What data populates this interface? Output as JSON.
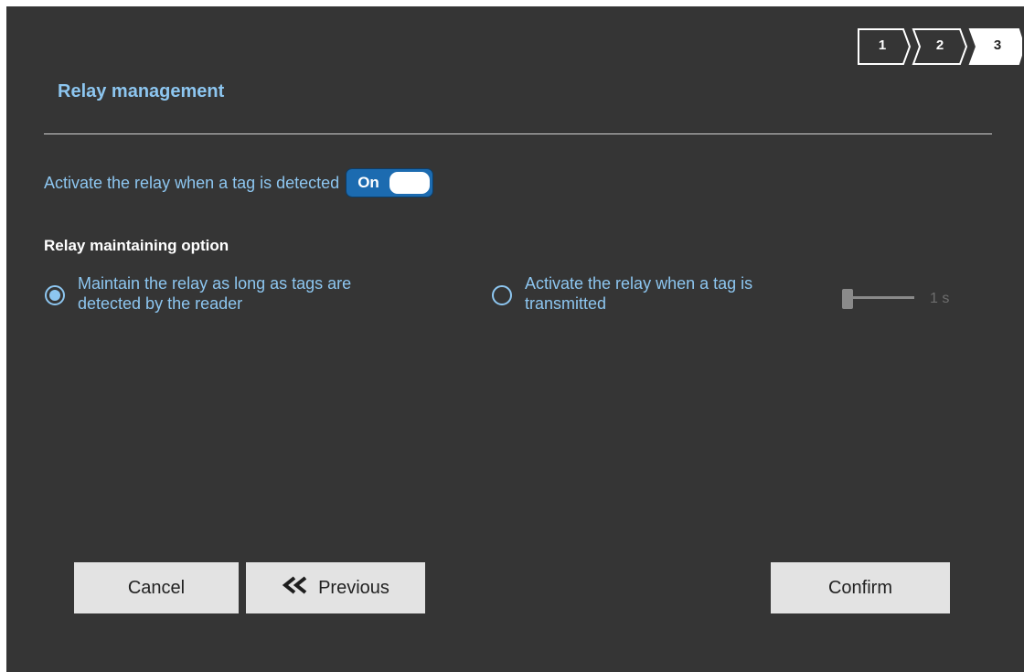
{
  "stepper": {
    "steps": [
      {
        "label": "1",
        "active": false
      },
      {
        "label": "2",
        "active": false
      },
      {
        "label": "3",
        "active": true
      }
    ]
  },
  "header": {
    "title": "Relay management"
  },
  "activate": {
    "label": "Activate the relay when a tag is detected",
    "toggle_label": "On",
    "toggle_state": true
  },
  "maintaining": {
    "section_label": "Relay maintaining option",
    "options": [
      {
        "label_line1": "Maintain the relay as long as tags are",
        "label_line2": "detected by the reader",
        "checked": true
      },
      {
        "label_line1": "Activate the relay when a tag is",
        "label_line2": "transmitted",
        "checked": false
      }
    ],
    "duration_value": "1 s",
    "duration_seconds": 1
  },
  "buttons": {
    "cancel": "Cancel",
    "previous": "Previous",
    "previous_icon": "double-chevron-left-icon",
    "confirm": "Confirm"
  },
  "colors": {
    "background": "#353535",
    "accent": "#8dc6f0",
    "toggle_on": "#1c6bb0",
    "button_bg": "#e3e3e3"
  }
}
